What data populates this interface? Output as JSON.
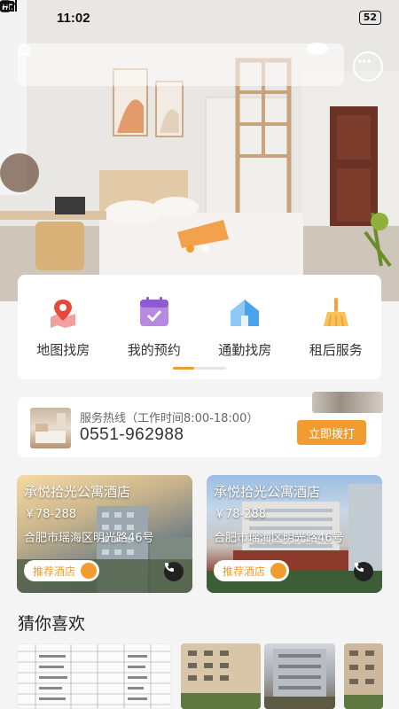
{
  "status_bar": {
    "time": "11:02",
    "battery": "52",
    "hd": "HD",
    "network": "5G"
  },
  "search": {
    "placeholder": ""
  },
  "menu": [
    {
      "label": "地图找房",
      "icon": "map-pin-icon"
    },
    {
      "label": "我的预约",
      "icon": "calendar-check-icon"
    },
    {
      "label": "通勤找房",
      "icon": "house-icon"
    },
    {
      "label": "租后服务",
      "icon": "broom-icon"
    }
  ],
  "hotline": {
    "label": "服务热线（工作时间8:00-18:00）",
    "phone": "0551-962988",
    "button": "立即拨打"
  },
  "hotels": [
    {
      "name": "承悦拾光公寓酒店",
      "price": "￥78-288",
      "address": "合肥市瑶海区明光路46号",
      "badge": "推荐酒店"
    },
    {
      "name": "承悦拾光公寓酒店",
      "price": "￥78-288",
      "address": "合肥市瑶海区明光路46号",
      "badge": "推荐酒店"
    }
  ],
  "guess": {
    "title": "猜你喜欢"
  },
  "colors": {
    "accent": "#f29b2e"
  }
}
